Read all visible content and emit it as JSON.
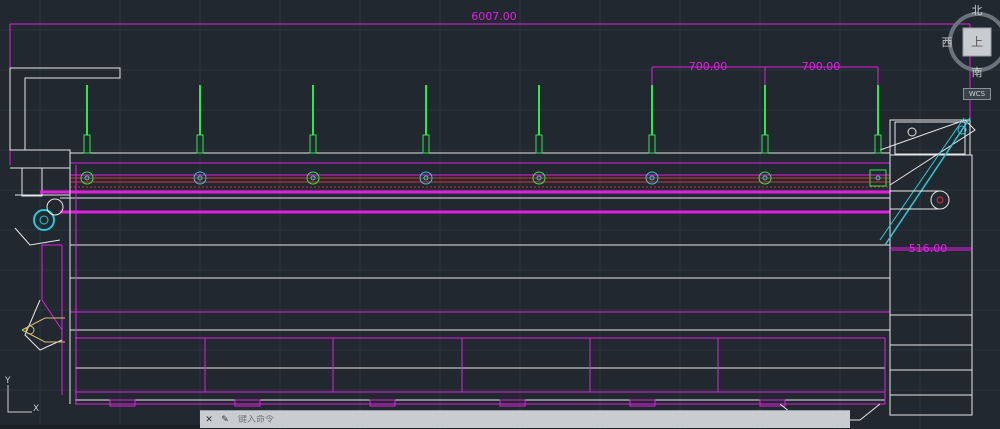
{
  "dimensions": {
    "overall": "6007.00",
    "spacing_a": "700.00",
    "spacing_b": "700.00",
    "right_offset": "516.00"
  },
  "viewcube": {
    "north": "北",
    "south": "南",
    "west": "西",
    "top": "上",
    "wcs": "WCS"
  },
  "ucs": {
    "x": "X",
    "y": "Y"
  },
  "command_line": {
    "close_glyph": "✕",
    "tool_glyph": "✎",
    "placeholder": "键入命令"
  },
  "colors": {
    "background": "#212830",
    "magenta": "#e020e0",
    "white": "#e8e8e8",
    "green": "#2ee84a",
    "cyan": "#2cc8d8",
    "red": "#e03030"
  }
}
